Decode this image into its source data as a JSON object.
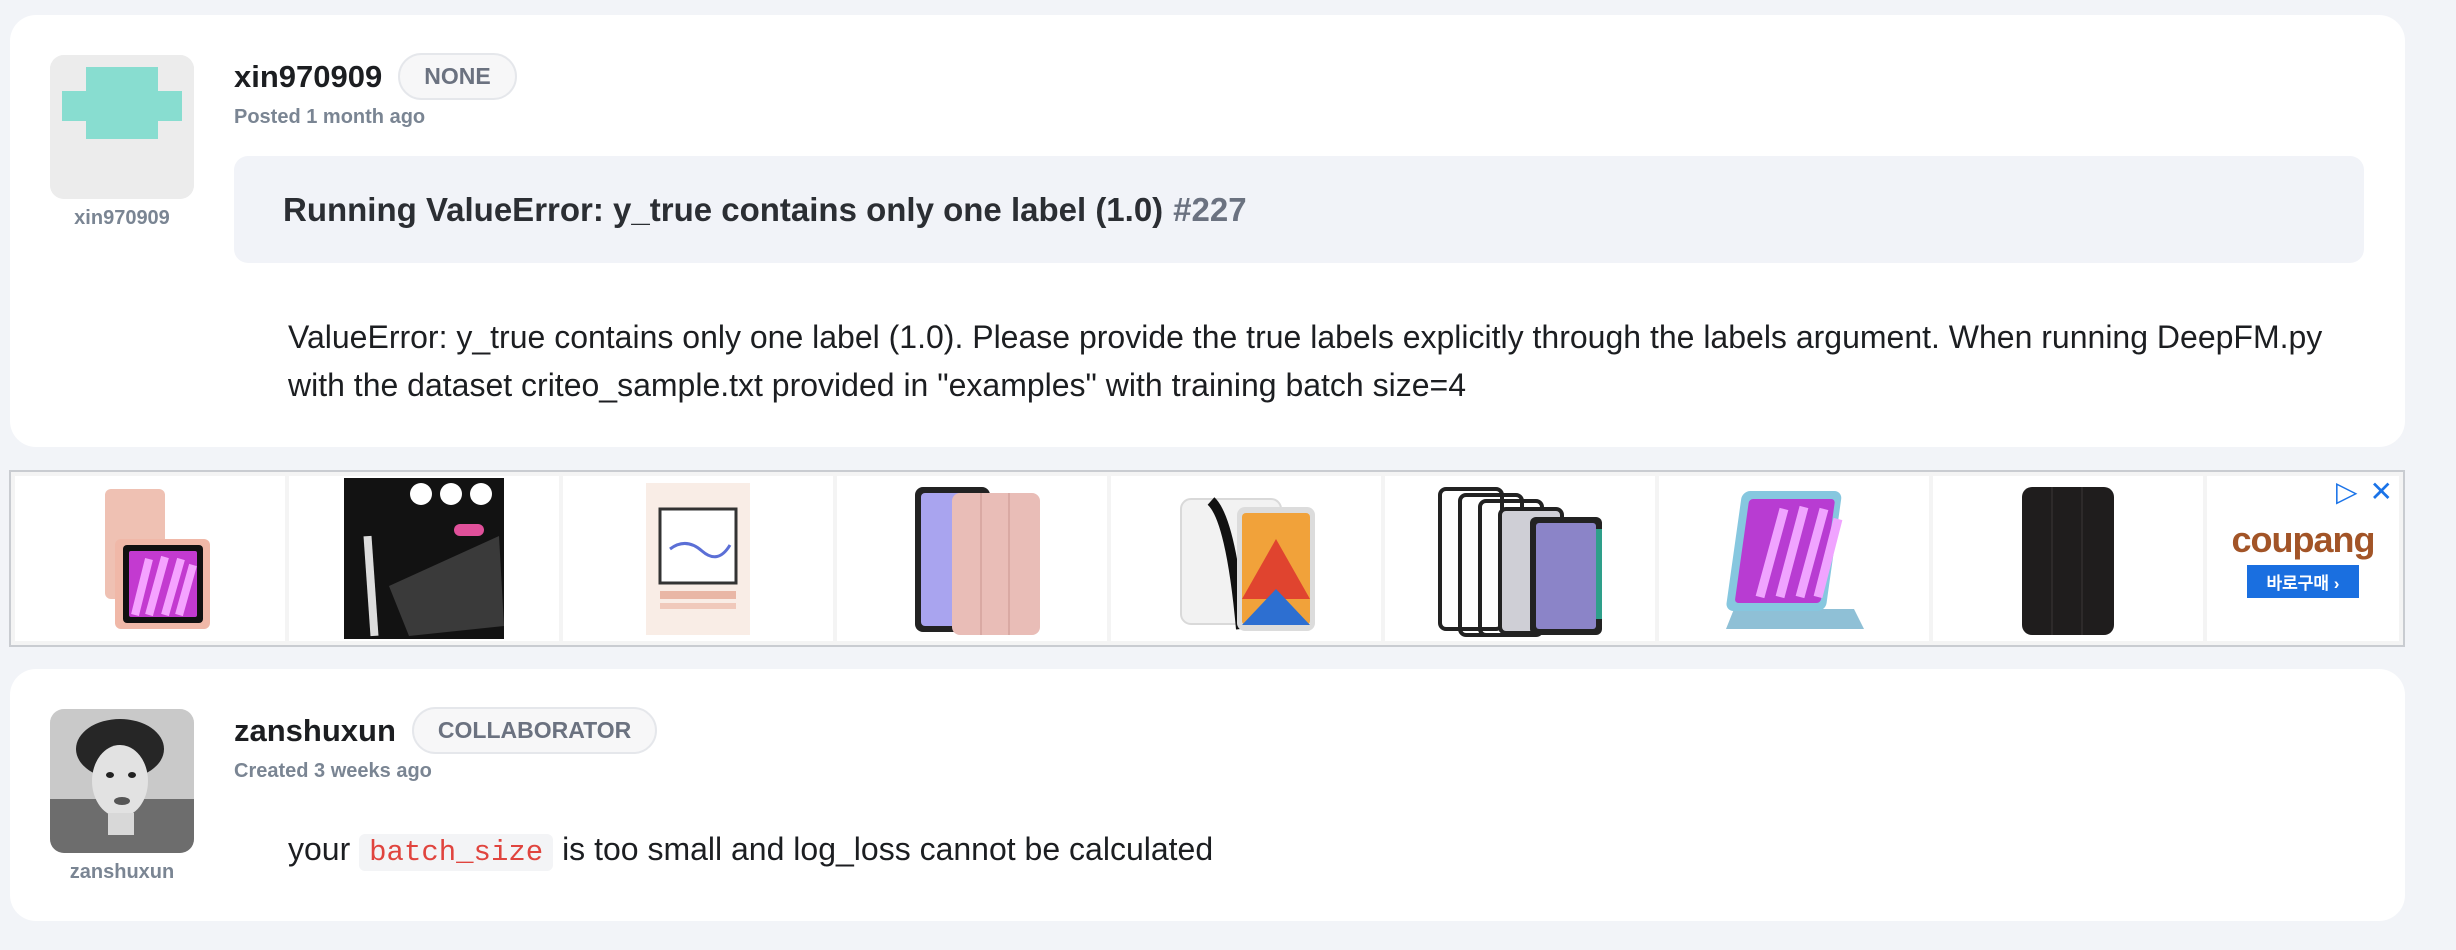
{
  "comments": [
    {
      "author": "xin970909",
      "badge": "NONE",
      "posted": "Posted 1 month ago",
      "avatar_label": "xin970909",
      "title": "Running ValueError: y_true contains only one label (1.0)",
      "issue_number": "#227",
      "body": "ValueError: y_true contains only one label (1.0). Please provide the true labels explicitly through the labels argument. When running DeepFM.py with the dataset criteo_sample.txt provided in \"examples\" with training batch size=4"
    },
    {
      "author": "zanshuxun",
      "badge": "COLLABORATOR",
      "posted": "Created 3 weeks ago",
      "avatar_label": "zanshuxun",
      "body_prefix": "your",
      "body_code": "batch_size",
      "body_suffix": "is too small and log_loss cannot be calculated"
    }
  ],
  "ad": {
    "brand_text": "coupang",
    "cta": "바로구매 ›",
    "products": [
      "tablet-case-pink",
      "stylus-pen",
      "screen-protector",
      "tablet-case-lavender",
      "tablet-clear-case",
      "tablet-case-set",
      "tablet-rotating-case",
      "tablet-case-black"
    ],
    "colors": {
      "brand_button": "#1a6fe0",
      "adchoices": "#1a73e8"
    }
  },
  "colors": {
    "accent_code": "#e0443e",
    "avatar_teal": "#88ddd0",
    "background": "#f2f4f8"
  }
}
